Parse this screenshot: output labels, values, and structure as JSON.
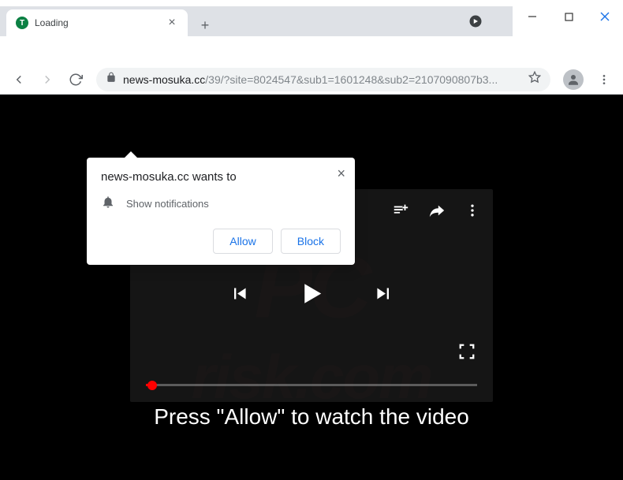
{
  "window": {
    "tab_title": "Loading"
  },
  "toolbar": {
    "url_host": "news-mosuka.cc",
    "url_path": "/39/?site=8024547&sub1=1601248&sub2=2107090807b3..."
  },
  "permission": {
    "title": "news-mosuka.cc wants to",
    "request_text": "Show notifications",
    "allow_label": "Allow",
    "block_label": "Block"
  },
  "page": {
    "caption": "Press \"Allow\" to watch the video"
  },
  "watermark": {
    "top": "PC",
    "bottom": "risk.com"
  }
}
